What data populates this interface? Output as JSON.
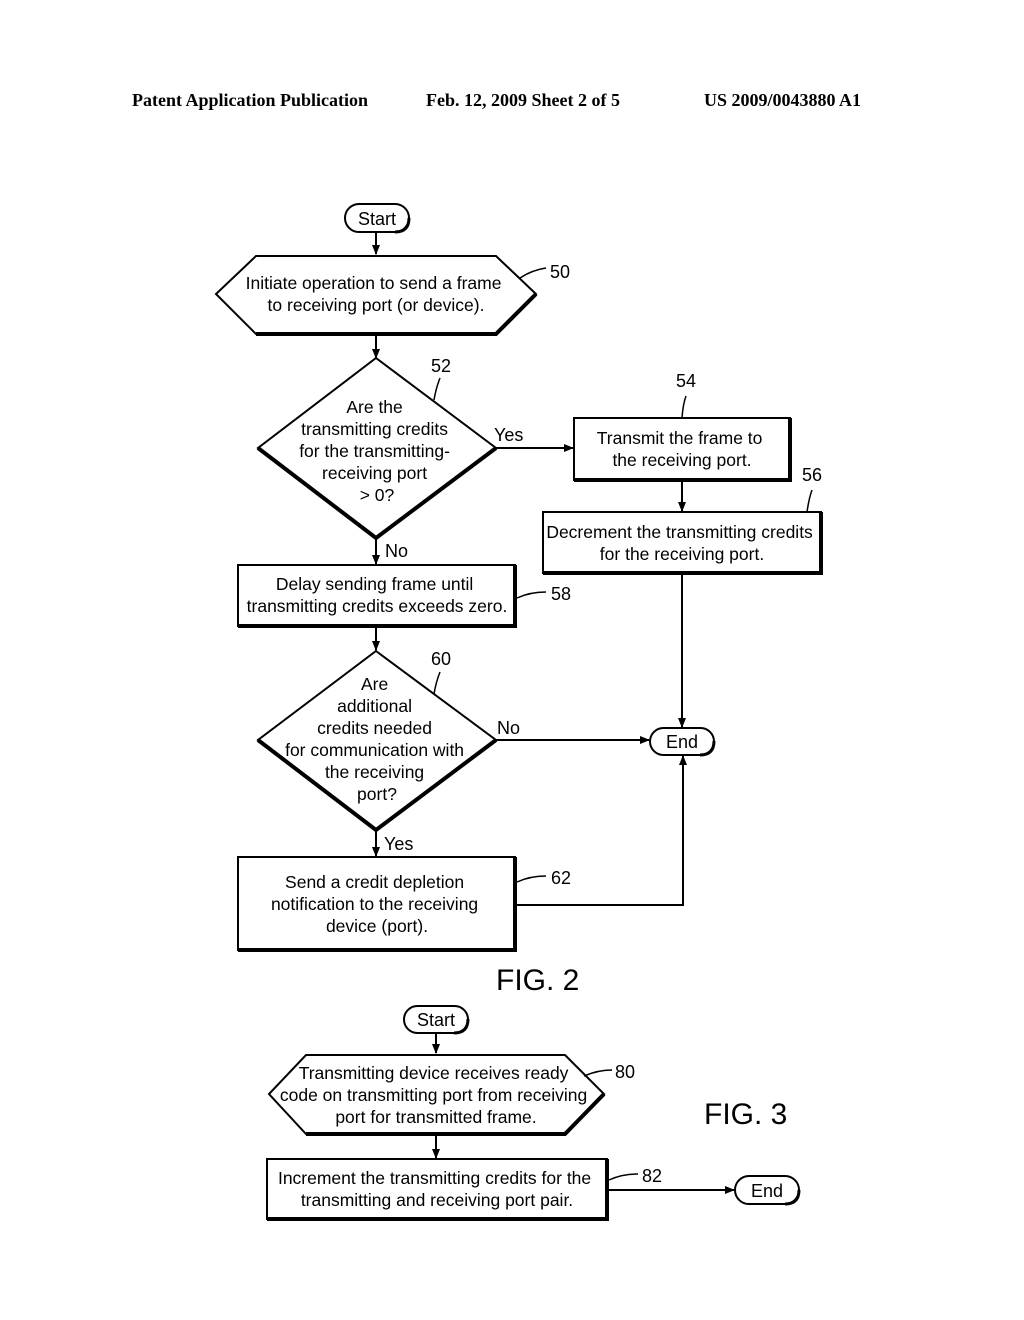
{
  "header": {
    "publication": "Patent Application Publication",
    "date_sheet": "Feb. 12, 2009   Sheet 2 of 5",
    "number": "US 2009/0043880 A1"
  },
  "fig2": {
    "caption": "FIG. 2",
    "start": "Start",
    "end": "End",
    "step50": {
      "ref": "50",
      "lines": [
        "Initiate operation to send a frame",
        "to receiving port (or device)."
      ]
    },
    "step52": {
      "ref": "52",
      "lines": [
        "Are the",
        "transmitting credits",
        "for the transmitting-",
        "receiving port",
        "> 0?"
      ],
      "yes": "Yes",
      "no": "No"
    },
    "step54": {
      "ref": "54",
      "lines": [
        "Transmit the frame to",
        "the receiving port."
      ]
    },
    "step56": {
      "ref": "56",
      "lines": [
        "Decrement the transmitting credits",
        "for the receiving port."
      ]
    },
    "step58": {
      "ref": "58",
      "lines": [
        "Delay sending frame until",
        "transmitting credits exceeds zero."
      ]
    },
    "step60": {
      "ref": "60",
      "lines": [
        "Are",
        "additional",
        "credits needed",
        "for communication with",
        "the receiving",
        "port?"
      ],
      "yes": "Yes",
      "no": "No"
    },
    "step62": {
      "ref": "62",
      "lines": [
        "Send a credit depletion",
        "notification to the receiving",
        "device (port)."
      ]
    }
  },
  "fig3": {
    "caption": "FIG. 3",
    "start": "Start",
    "end": "End",
    "step80": {
      "ref": "80",
      "lines": [
        "Transmitting device receives ready",
        "code on transmitting port from receiving",
        "port for transmitted frame."
      ]
    },
    "step82": {
      "ref": "82",
      "lines": [
        "Increment the transmitting credits for the",
        "transmitting and receiving port pair."
      ]
    }
  }
}
